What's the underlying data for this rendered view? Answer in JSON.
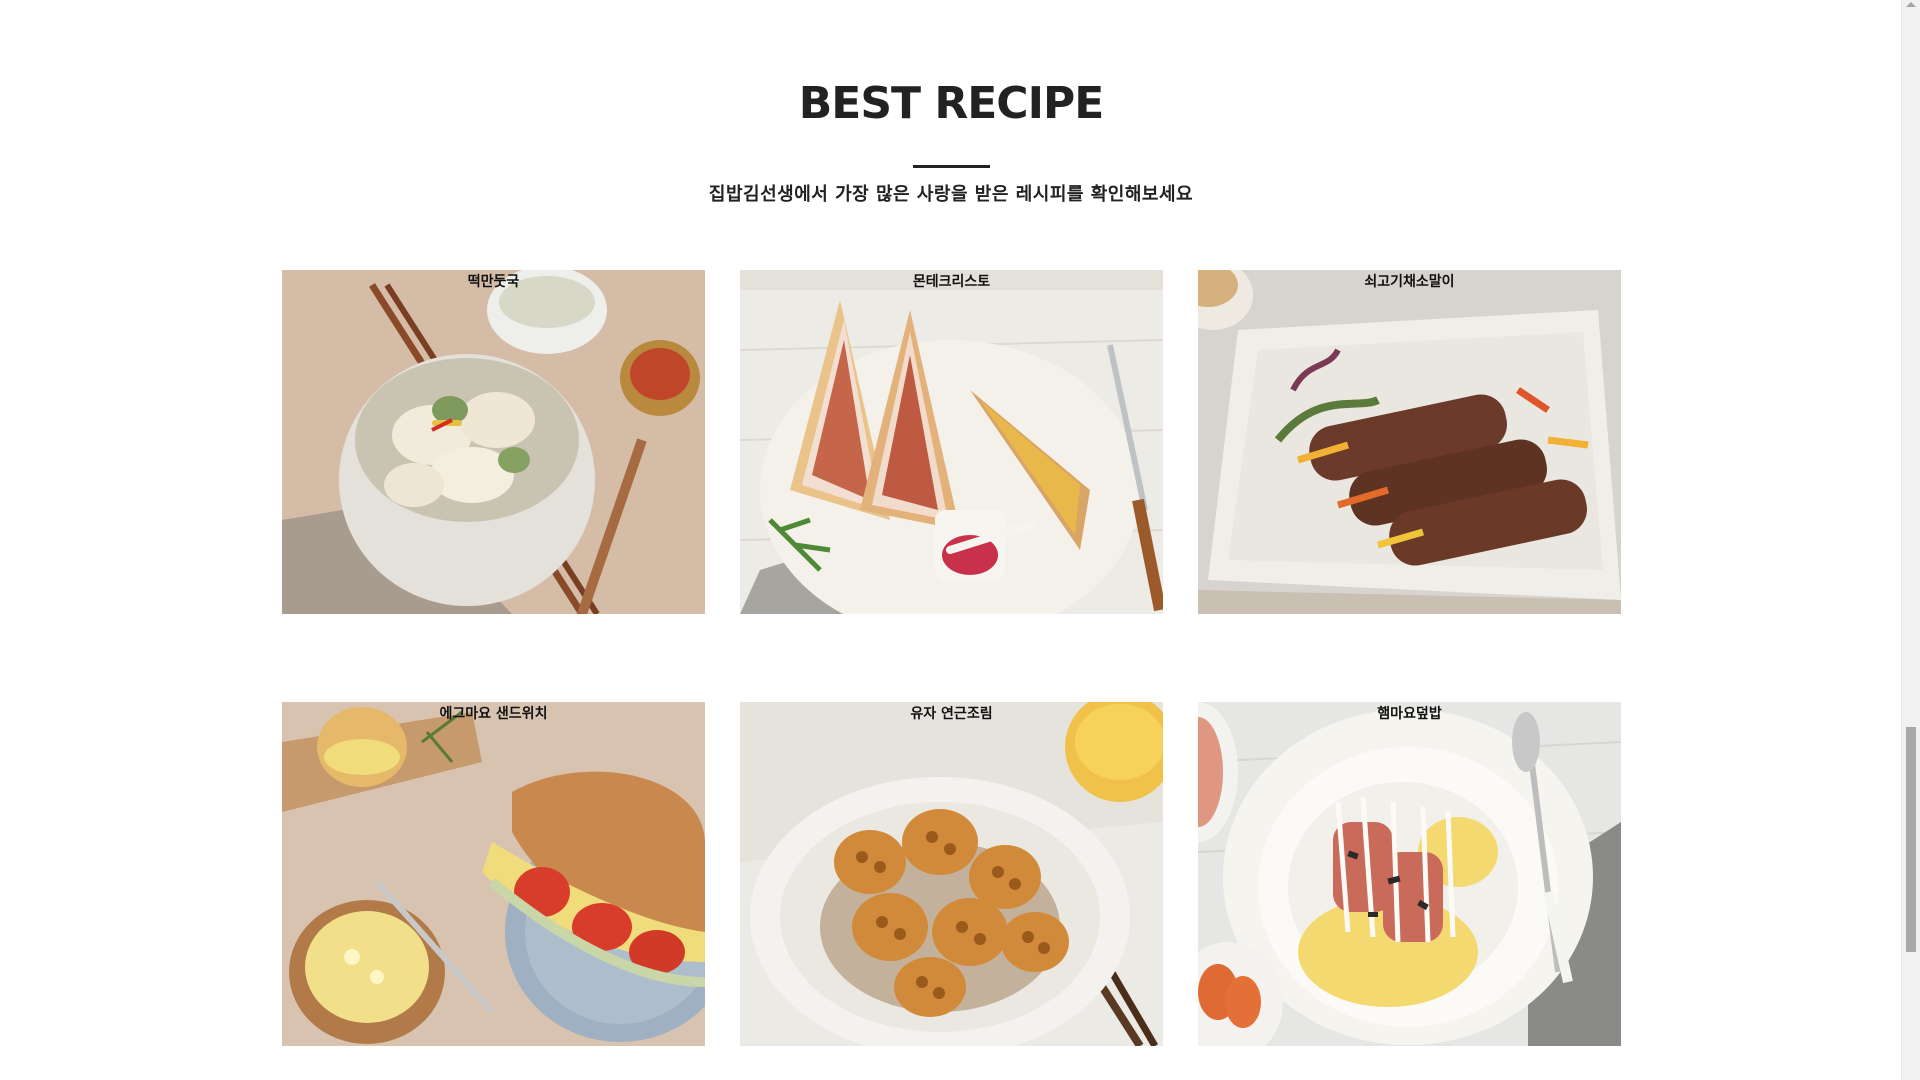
{
  "section": {
    "title": "BEST RECIPE",
    "subtitle": "집밥김선생에서 가장 많은 사랑을 받은 레시피를 확인해보세요"
  },
  "recipes": [
    {
      "name": "떡만둣국"
    },
    {
      "name": "몬테크리스토"
    },
    {
      "name": "쇠고기채소말이"
    },
    {
      "name": "에그마요 샌드위치"
    },
    {
      "name": "유자 연근조림"
    },
    {
      "name": "햄마요덮밥"
    }
  ]
}
